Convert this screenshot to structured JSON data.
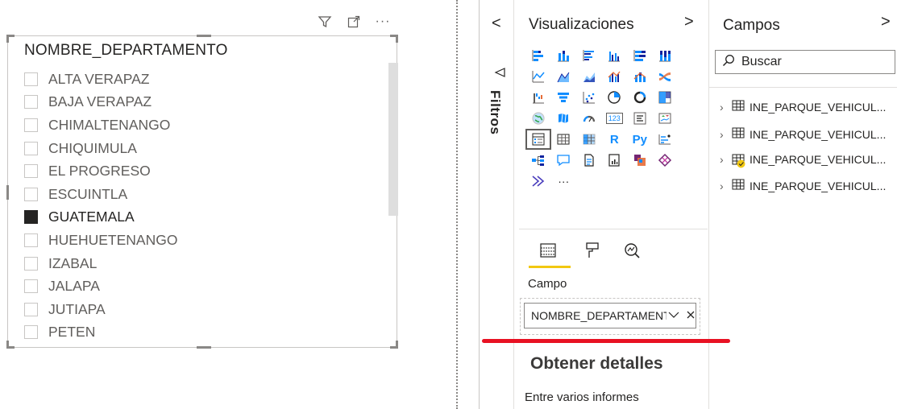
{
  "slicer": {
    "title": "NOMBRE_DEPARTAMENTO",
    "header_icons": [
      "filter-icon",
      "focus-mode-icon",
      "more-options-icon"
    ],
    "more_label": "···",
    "items": [
      {
        "label": "ALTA VERAPAZ",
        "checked": false
      },
      {
        "label": "BAJA VERAPAZ",
        "checked": false
      },
      {
        "label": "CHIMALTENANGO",
        "checked": false
      },
      {
        "label": "CHIQUIMULA",
        "checked": false
      },
      {
        "label": "EL PROGRESO",
        "checked": false
      },
      {
        "label": "ESCUINTLA",
        "checked": false
      },
      {
        "label": "GUATEMALA",
        "checked": true
      },
      {
        "label": "HUEHUETENANGO",
        "checked": false
      },
      {
        "label": "IZABAL",
        "checked": false
      },
      {
        "label": "JALAPA",
        "checked": false
      },
      {
        "label": "JUTIAPA",
        "checked": false
      },
      {
        "label": "PETEN",
        "checked": false
      }
    ]
  },
  "filters_pane": {
    "label": "Filtros",
    "chevron": "<"
  },
  "visualizations": {
    "title": "Visualizaciones",
    "chevron": ">",
    "icons": [
      "stacked-bar-chart-icon",
      "stacked-column-chart-icon",
      "clustered-bar-chart-icon",
      "clustered-column-chart-icon",
      "100-stacked-bar-chart-icon",
      "100-stacked-column-chart-icon",
      "line-chart-icon",
      "area-chart-icon",
      "stacked-area-chart-icon",
      "line-clustered-column-chart-icon",
      "line-stacked-column-chart-icon",
      "ribbon-chart-icon",
      "waterfall-chart-icon",
      "funnel-chart-icon",
      "scatter-chart-icon",
      "pie-chart-icon",
      "donut-chart-icon",
      "treemap-icon",
      "map-icon",
      "filled-map-icon",
      "gauge-icon",
      "card-icon",
      "multi-row-card-icon",
      "kpi-icon",
      "slicer-icon",
      "table-icon",
      "matrix-icon",
      "r-visual-icon",
      "python-visual-icon",
      "key-influencers-icon",
      "decomposition-tree-icon",
      "qa-icon",
      "smart-narrative-icon",
      "paginated-report-icon",
      "power-apps-icon",
      "power-automate-icon",
      "get-more-visuals-icon",
      "more-visuals-icon"
    ],
    "text_icons": {
      "r": "R",
      "py": "Py",
      "card": "123",
      "more": "···"
    },
    "selected_icon": "slicer-icon",
    "tabs": [
      "fields-tab-icon",
      "format-tab-icon",
      "analytics-tab-icon"
    ],
    "active_tab": "fields-tab-icon",
    "field_section_label": "Campo",
    "field_value": "NOMBRE_DEPARTAMENTO",
    "details_title": "Obtener detalles",
    "details_subtitle": "Entre varios informes",
    "accent_color": "#f2c811",
    "highlight_line_color": "#e81123"
  },
  "fields": {
    "title": "Campos",
    "chevron": ">",
    "search_placeholder": "Buscar",
    "tables": [
      {
        "name": "INE_PARQUE_VEHICUL...",
        "status": null
      },
      {
        "name": "INE_PARQUE_VEHICUL...",
        "status": null
      },
      {
        "name": "INE_PARQUE_VEHICUL...",
        "status": "in-use-badge"
      },
      {
        "name": "INE_PARQUE_VEHICUL...",
        "status": null
      }
    ]
  }
}
